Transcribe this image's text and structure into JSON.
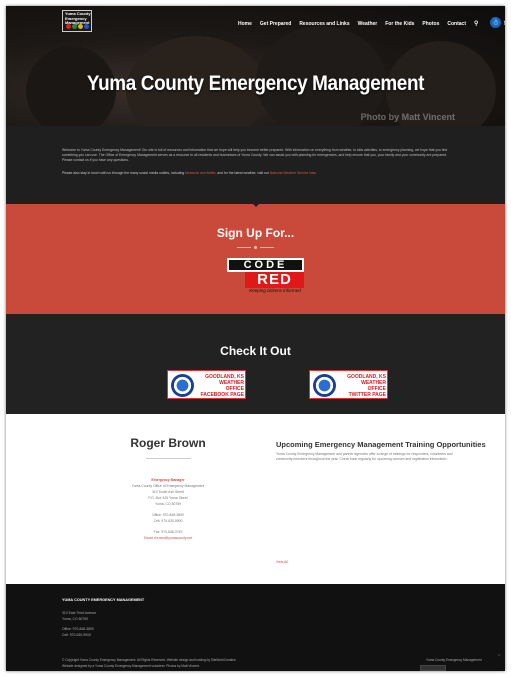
{
  "header": {
    "logo_text": "Yuma County Emergency Management",
    "nav": [
      "Home",
      "Get Prepared",
      "Resources and Links",
      "Weather",
      "For the Kids",
      "Photos",
      "Contact"
    ],
    "search_icon": "search-icon",
    "social_icons": [
      "twitter-icon",
      "facebook-icon"
    ],
    "accessibility_icon": "accessibility-icon"
  },
  "hero": {
    "title": "Yuma County Emergency Management",
    "photo_credit": "Photo by Matt Vincent"
  },
  "welcome": {
    "paragraph1": "Welcome to Yuma County Emergency Management! Our site is full of resources and information that we hope will help you become better prepared. With information on everything from weather, to kids activities, to emergency planning, we hope that you find something you can use. The Office of Emergency Management serves as a resource to all residents and businesses of Yuma County. We can assist you with planning for emergencies, and help ensure that you, your family and your community are prepared. Please contact us if you have any questions.",
    "paragraph2_lead": "Please also stay in touch with us through the many social media outlets, including ",
    "paragraph2_link1": "facebook and twitter",
    "paragraph2_mid": ", and for the latest weather, visit our ",
    "paragraph2_link2": "National Weather Service links"
  },
  "signup": {
    "title": "Sign Up For...",
    "codered_top": "CODE",
    "codered_red": "RED",
    "codered_tag": "Keeping citizens informed"
  },
  "checkout": {
    "title": "Check It Out",
    "left_card": [
      "GOODLAND, KS",
      "WEATHER",
      "OFFICE",
      "FACEBOOK PAGE"
    ],
    "right_card": [
      "GOODLAND, KS",
      "WEATHER",
      "OFFICE",
      "TWITTER PAGE"
    ]
  },
  "contact": {
    "name": "Roger Brown",
    "role": "Emergency Manager",
    "lines": [
      "Yuma County Office of Emergency Management",
      "310 South Ash Street",
      "P.O. Box 426 Yuma Street",
      "Yuma, CO 80759"
    ],
    "phones": [
      "Office: 970-848-3890",
      "Cell: 970-630-9900"
    ],
    "fax": "Fax: 970-848-3749",
    "email": "Email: rbrown@yumacounty.net"
  },
  "training": {
    "title": "Upcoming Emergency Management Training Opportunities",
    "text": "Yuma County Emergency Management and partner agencies offer a range of trainings for responders, volunteers and community members throughout the year. Check back regularly for upcoming courses and registration information.",
    "view_all": "View All"
  },
  "footer": {
    "title": "YUMA COUNTY EMERGENCY MANAGEMENT",
    "address1": "310 East Third Avenue",
    "address2": "Yuma, CO 80759",
    "office": "Office: 970-848-3890",
    "cell": "Cell: 970-630-9900",
    "copyright": "© Copyright Yuma County Emergency Management. All Rights Reserved. Website design and hosting by SiteWorkCreative.",
    "credit": "Website designed by a Yuma County Emergency Management volunteer. Photos by Matt Vincent.",
    "right_text": "Yuma County Emergency Management",
    "to_top": "^"
  },
  "colors": {
    "accent_red": "#c94a3a",
    "dark": "#1f1f1f",
    "codered_red": "#e01818"
  }
}
